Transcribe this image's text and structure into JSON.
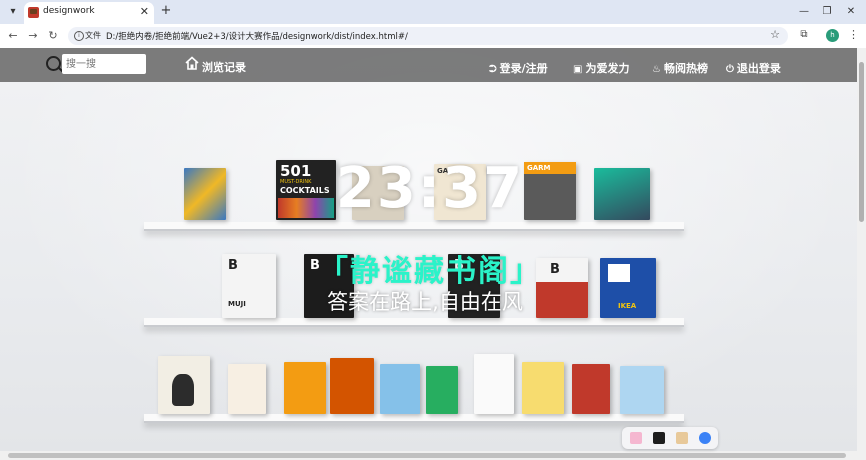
{
  "browser": {
    "tab_title": "designwork",
    "scheme_chip": "文件",
    "url": "D:/拒绝内卷/拒绝前端/Vue2+3/设计大赛作品/designwork/dist/index.html#/",
    "profile_initial": "h"
  },
  "header": {
    "search_placeholder": "搜一搜",
    "history_label": "浏览记录",
    "nav": [
      {
        "label": "登录/注册",
        "icon": "login-icon"
      },
      {
        "label": "为爱发力",
        "icon": "ticket-icon"
      },
      {
        "label": "畅阅热榜",
        "icon": "flame-icon"
      },
      {
        "label": "退出登录",
        "icon": "logout-icon"
      }
    ]
  },
  "hero": {
    "clock": "23:37",
    "title": "「静谧藏书阁」",
    "motto": "答案在路上,自由在风"
  },
  "books": {
    "cocktails_number": "501",
    "cocktails_sub": "MUST-DRINK",
    "cocktails_title": "COCKTAILS",
    "garm_1": "GARM",
    "garm_2": "GARM",
    "b_mag_1": "B",
    "b_mag_2": "B",
    "b_mag_3": "B",
    "b_mag_4": "B",
    "muji": "MUJI",
    "ikea": "IKEA"
  },
  "colors": {
    "title_accent": "#2af3c9",
    "header_bg": "#6e6e6e"
  }
}
